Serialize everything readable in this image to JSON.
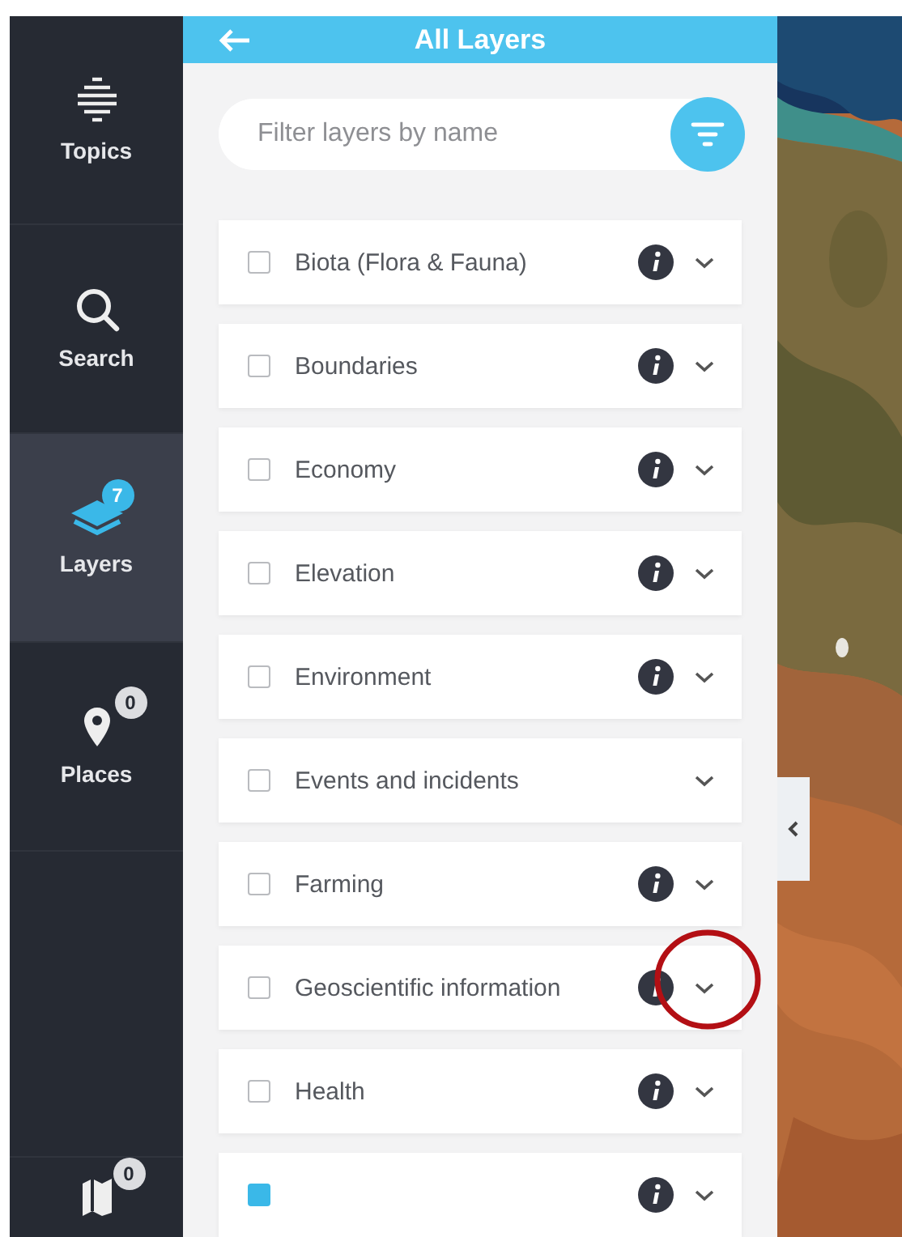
{
  "sidebar": {
    "items": [
      {
        "kind": "topics",
        "label": "Topics",
        "selected": false
      },
      {
        "kind": "search",
        "label": "Search",
        "selected": false
      },
      {
        "kind": "layers",
        "label": "Layers",
        "selected": true,
        "badge": "7"
      },
      {
        "kind": "places",
        "label": "Places",
        "selected": false,
        "badge": "0"
      },
      {
        "kind": "maps",
        "selected": false,
        "badge": "0"
      }
    ]
  },
  "panel": {
    "title": "All Layers",
    "search": {
      "placeholder": "Filter layers by name"
    },
    "layers": [
      {
        "label": "Biota (Flora & Fauna)",
        "checked": false,
        "info": true,
        "highlighted": false
      },
      {
        "label": "Boundaries",
        "checked": false,
        "info": true,
        "highlighted": false
      },
      {
        "label": "Economy",
        "checked": false,
        "info": true,
        "highlighted": false
      },
      {
        "label": "Elevation",
        "checked": false,
        "info": true,
        "highlighted": false
      },
      {
        "label": "Environment",
        "checked": false,
        "info": true,
        "highlighted": false
      },
      {
        "label": "Events and incidents",
        "checked": false,
        "info": false,
        "highlighted": false
      },
      {
        "label": "Farming",
        "checked": false,
        "info": true,
        "highlighted": false
      },
      {
        "label": "Geoscientific information",
        "checked": false,
        "info": true,
        "highlighted": true
      },
      {
        "label": "Health",
        "checked": false,
        "info": true,
        "highlighted": false
      },
      {
        "checked": true,
        "info": true,
        "highlighted": false
      }
    ]
  }
}
